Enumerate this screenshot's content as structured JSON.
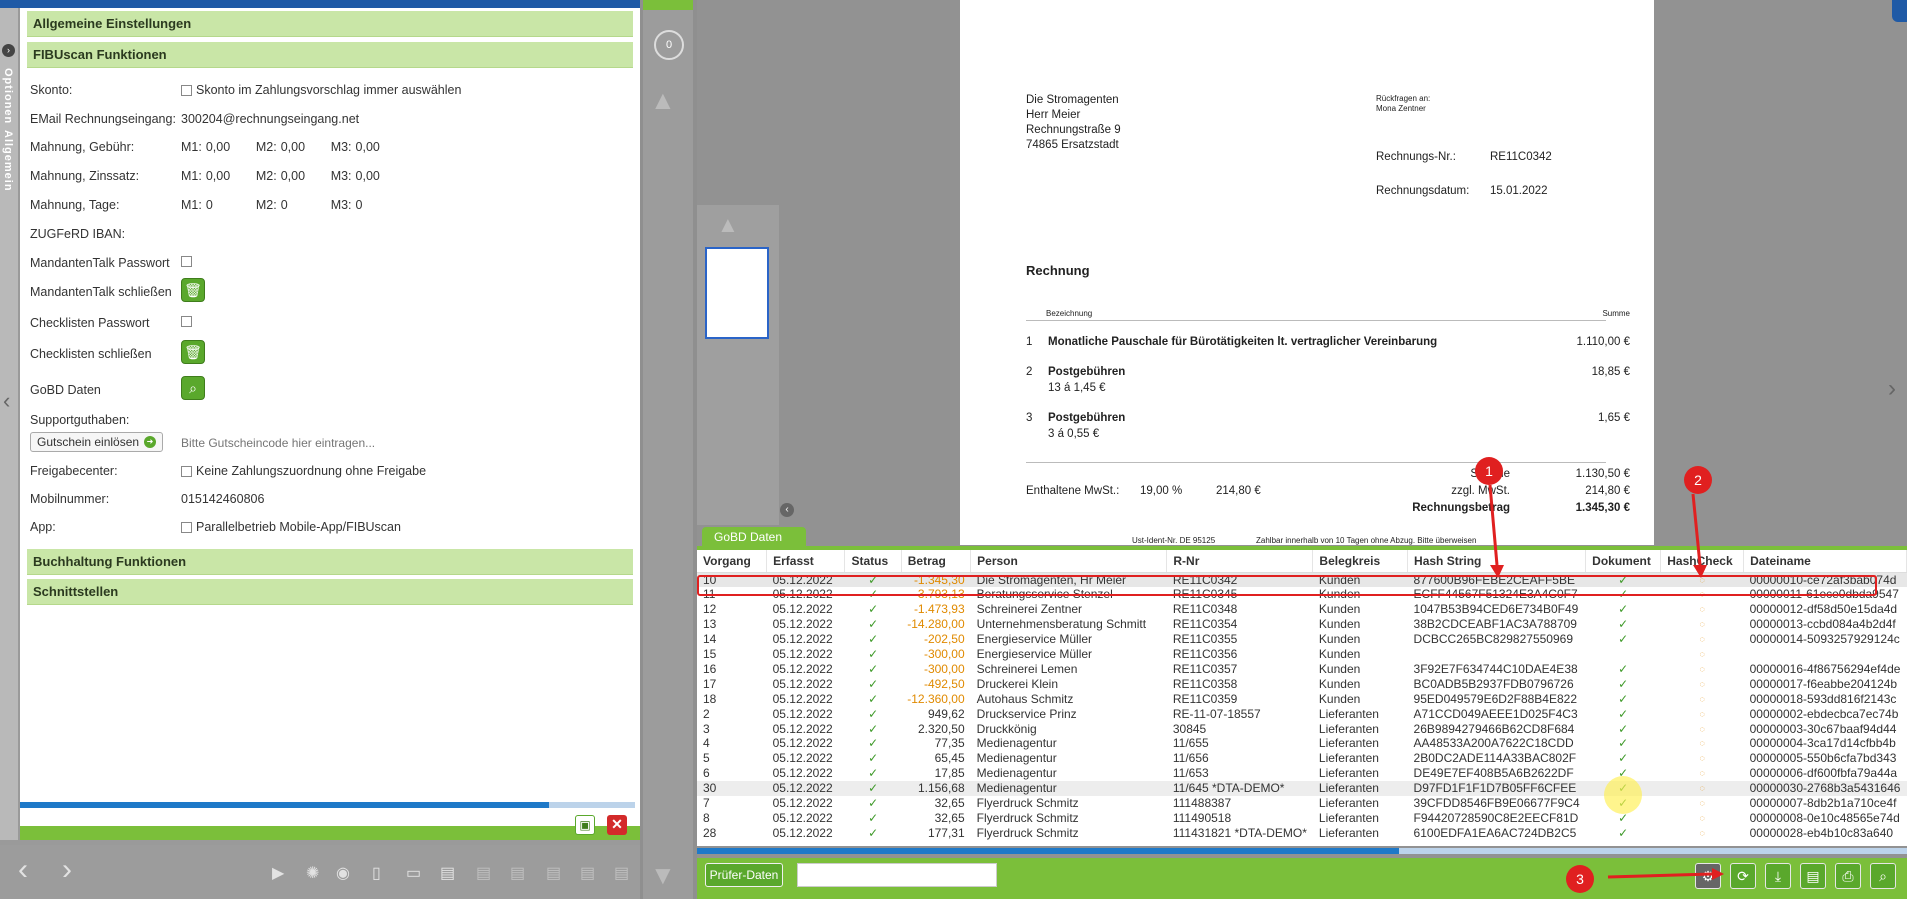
{
  "left": {
    "sidebar_labels": [
      "Optionen",
      "Allgemein"
    ],
    "sections": {
      "general": "Allgemeine Einstellungen",
      "fibu": "FIBUscan Funktionen",
      "bookkeeping": "Buchhaltung Funktionen",
      "interfaces": "Schnittstellen"
    },
    "fields": {
      "skonto_label": "Skonto:",
      "skonto_value": "Skonto im Zahlungsvorschlag immer auswählen",
      "email_label": "EMail Rechnungseingang:",
      "email_value": "300204@rechnungseingang.net",
      "fee_label": "Mahnung, Gebühr:",
      "fee": {
        "m1_label": "M1:",
        "m1": "0,00",
        "m2_label": "M2:",
        "m2": "0,00",
        "m3_label": "M3:",
        "m3": "0,00"
      },
      "interest_label": "Mahnung, Zinssatz:",
      "interest": {
        "m1_label": "M1:",
        "m1": "0,00",
        "m2_label": "M2:",
        "m2": "0,00",
        "m3_label": "M3:",
        "m3": "0,00"
      },
      "days_label": "Mahnung, Tage:",
      "days": {
        "m1_label": "M1:",
        "m1": "0",
        "m2_label": "M2:",
        "m2": "0",
        "m3_label": "M3:",
        "m3": "0"
      },
      "zugferd_label": "ZUGFeRD IBAN:",
      "mt_pw_label": "MandantenTalk Passwort",
      "mt_close_label": "MandantenTalk schließen",
      "cl_pw_label": "Checklisten Passwort",
      "cl_close_label": "Checklisten schließen",
      "gobd_label": "GoBD Daten",
      "support_label": "Supportguthaben:",
      "voucher_button": "Gutschein einlösen",
      "voucher_placeholder": "Bitte Gutscheincode hier eintragen...",
      "release_label": "Freigabecenter:",
      "release_value": "Keine Zahlungszuordnung ohne Freigabe",
      "mobile_label": "Mobilnummer:",
      "mobile_value": "015142460806",
      "app_label": "App:",
      "app_value": "Parallelbetrieb Mobile-App/FIBUscan"
    }
  },
  "viewer": {
    "page_counter": "0"
  },
  "invoice": {
    "recipient": [
      "Die Stromagenten",
      "Herr Meier",
      "Rechnungstraße 9",
      "74865 Ersatzstadt"
    ],
    "contact_label": "Rückfragen an:",
    "contact_name": "Mona Zentner",
    "number_label": "Rechnungs-Nr.:",
    "number": "RE11C0342",
    "date_label": "Rechnungsdatum:",
    "date": "15.01.2022",
    "title": "Rechnung",
    "col_desc": "Bezeichnung",
    "col_sum": "Summe",
    "items": [
      {
        "no": "1",
        "desc": "Monatliche Pauschale für Bürotätigkeiten lt. vertraglicher Vereinbarung",
        "sub": "",
        "amount": "1.110,00 €"
      },
      {
        "no": "2",
        "desc": "Postgebühren",
        "sub": "13 á 1,45 €",
        "amount": "18,85 €"
      },
      {
        "no": "3",
        "desc": "Postgebühren",
        "sub": "3 á 0,55 €",
        "amount": "1,65 €"
      }
    ],
    "sum_label": "Summe",
    "sum": "1.130,50 €",
    "vat_included_label": "Enthaltene MwSt.:",
    "vat_rate": "19,00 %",
    "vat_amount": "214,80 €",
    "plus_vat_label": "zzgl. MwSt.",
    "plus_vat": "214,80 €",
    "total_label": "Rechnungsbetrag",
    "total": "1.345,30 €",
    "footer_vat_id": "Ust-Ident-Nr. DE 95125",
    "footer_terms": "Zahlbar innerhalb von 10 Tagen ohne Abzug. Bitte überweisen"
  },
  "gobd": {
    "tab_label": "GoBD Daten",
    "columns": [
      "Vorgang",
      "Erfasst",
      "Status",
      "Betrag",
      "Person",
      "R-Nr",
      "Belegkreis",
      "Hash String",
      "Dokument",
      "HashCheck",
      "Dateiname"
    ],
    "rows": [
      [
        "10",
        "05.12.2022",
        "✓",
        "-1.345,30",
        "Die Stromagenten, Hr Meier",
        "RE11C0342",
        "Kunden",
        "877600B96FEBE2CEAFF5BE",
        "✓",
        "◌",
        "00000010-ce72af3bab074d"
      ],
      [
        "11",
        "05.12.2022",
        "✓",
        "-3.793,13",
        "Beratungsservice Stenzel",
        "RE11C0345",
        "Kunden",
        "ECFF44567F51324E3A4C0F7",
        "✓",
        "◌",
        "00000011-61ece0dbda9547"
      ],
      [
        "12",
        "05.12.2022",
        "✓",
        "-1.473,93",
        "Schreinerei Zentner",
        "RE11C0348",
        "Kunden",
        "1047B53B94CED6E734B0F49",
        "✓",
        "◌",
        "00000012-df58d50e15da4d"
      ],
      [
        "13",
        "05.12.2022",
        "✓",
        "-14.280,00",
        "Unternehmensberatung Schmitt",
        "RE11C0354",
        "Kunden",
        "38B2CDCEABF1AC3A788709",
        "✓",
        "◌",
        "00000013-ccbd084a4b2d4f"
      ],
      [
        "14",
        "05.12.2022",
        "✓",
        "-202,50",
        "Energieservice Müller",
        "RE11C0355",
        "Kunden",
        "DCBCC265BC829827550969",
        "✓",
        "◌",
        "00000014-5093257929124c"
      ],
      [
        "15",
        "05.12.2022",
        "✓",
        "-300,00",
        "Energieservice Müller",
        "RE11C0356",
        "Kunden",
        "",
        "",
        "◌",
        ""
      ],
      [
        "16",
        "05.12.2022",
        "✓",
        "-300,00",
        "Schreinerei Lemen",
        "RE11C0357",
        "Kunden",
        "3F92E7F634744C10DAE4E38",
        "✓",
        "◌",
        "00000016-4f86756294ef4de"
      ],
      [
        "17",
        "05.12.2022",
        "✓",
        "-492,50",
        "Druckerei Klein",
        "RE11C0358",
        "Kunden",
        "BC0ADB5B2937FDB0796726",
        "✓",
        "◌",
        "00000017-f6eabbe204124b"
      ],
      [
        "18",
        "05.12.2022",
        "✓",
        "-12.360,00",
        "Autohaus Schmitz",
        "RE11C0359",
        "Kunden",
        "95ED049579E6D2F88B4E822",
        "✓",
        "◌",
        "00000018-593dd816f2143c"
      ],
      [
        "2",
        "05.12.2022",
        "✓",
        "949,62",
        "Druckservice Prinz",
        "RE-11-07-18557",
        "Lieferanten",
        "A71CCD049AEEE1D025F4C3",
        "✓",
        "◌",
        "00000002-ebdecbca7ec74b"
      ],
      [
        "3",
        "05.12.2022",
        "✓",
        "2.320,50",
        "Druckkönig",
        "30845",
        "Lieferanten",
        "26B9894279466B62CD8F684",
        "✓",
        "◌",
        "00000003-30c67baaf94d44"
      ],
      [
        "4",
        "05.12.2022",
        "✓",
        "77,35",
        "Medienagentur",
        "11/655",
        "Lieferanten",
        "AA48533A200A7622C18CDD",
        "✓",
        "◌",
        "00000004-3ca17d14cfbb4b"
      ],
      [
        "5",
        "05.12.2022",
        "✓",
        "65,45",
        "Medienagentur",
        "11/656",
        "Lieferanten",
        "2B0DC2ADE114A33BAC802F",
        "✓",
        "◌",
        "00000005-550b6cfa7bd343"
      ],
      [
        "6",
        "05.12.2022",
        "✓",
        "17,85",
        "Medienagentur",
        "11/653",
        "Lieferanten",
        "DE49E7EF408B5A6B2622DF",
        "✓",
        "◌",
        "00000006-df600fbfa79a44a"
      ],
      [
        "30",
        "05.12.2022",
        "✓",
        "1.156,68",
        "Medienagentur",
        "11/645 *DTA-DEMO*",
        "Lieferanten",
        "D97FD1F1F1D7B05FF6CFEE",
        "✓",
        "◌",
        "00000030-2768b3a5431646"
      ],
      [
        "7",
        "05.12.2022",
        "✓",
        "32,65",
        "Flyerdruck Schmitz",
        "111488387",
        "Lieferanten",
        "39CFDD8546FB9E06677F9C4",
        "✓",
        "◌",
        "00000007-8db2b1a710ce4f"
      ],
      [
        "8",
        "05.12.2022",
        "✓",
        "32,65",
        "Flyerdruck Schmitz",
        "111490518",
        "Lieferanten",
        "F94420728590C8E2EECF81D",
        "✓",
        "◌",
        "00000008-0e10c48565e74d"
      ],
      [
        "28",
        "05.12.2022",
        "✓",
        "177,31",
        "Flyerdruck Schmitz",
        "111431821 *DTA-DEMO*",
        "Lieferanten",
        "6100EDFA1EA6AC724DB2C5",
        "✓",
        "◌",
        "00000028-eb4b10c83a640"
      ]
    ],
    "pruefer_button": "Prüfer-Daten"
  },
  "annotations": {
    "m1": "1",
    "m2": "2",
    "m3": "3"
  },
  "colors": {
    "accent_green": "#7bbf3a",
    "brand_blue": "#1f5aa6",
    "annotation_red": "#e02020"
  }
}
